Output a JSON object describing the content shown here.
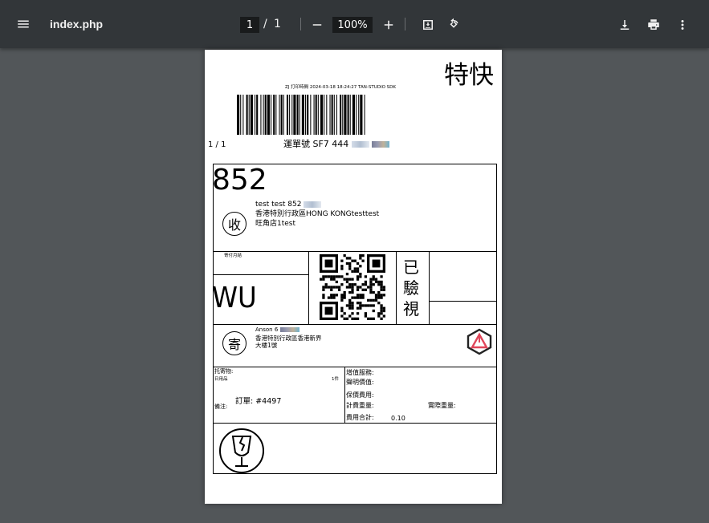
{
  "toolbar": {
    "file_name": "index.php",
    "current_page": "1",
    "page_separator": "/",
    "total_pages": "1",
    "zoom": "100%"
  },
  "label": {
    "service_type": "特快",
    "print_meta": "ZJ   打印時間   2024-03-18 18:24:27 TAN-STUDIO SDK",
    "page_count": "1 / 1",
    "waybill_label": "運單號",
    "waybill_prefix": "SF7    444",
    "area_code": "852",
    "receiver_badge": "收",
    "receiver_name": "test test   852",
    "receiver_addr1": "香港特別行政區HONG KONGtesttest",
    "receiver_addr2": "旺角店1test",
    "monthly_account_label": "寄付月結",
    "route_code": "WU",
    "checked_label": "已驗視",
    "sender_badge": "寄",
    "sender_name": "Anson   6",
    "sender_addr1": "香港特別行政區香港新界",
    "sender_addr2": "大樓1號",
    "goods_label": "托寄物:",
    "goods_value": "日用品",
    "goods_qty": "1件",
    "remark_label": "備注:",
    "order_text": "訂單: #4497",
    "vas_label": "增值服務:",
    "declared_value_label": "聲明價值:",
    "insurance_fee_label": "保價費用:",
    "charge_weight_label": "計費重量:",
    "actual_weight_label": "實際重量:",
    "total_fee_label": "費用合計:",
    "total_fee_value": "0.10"
  }
}
